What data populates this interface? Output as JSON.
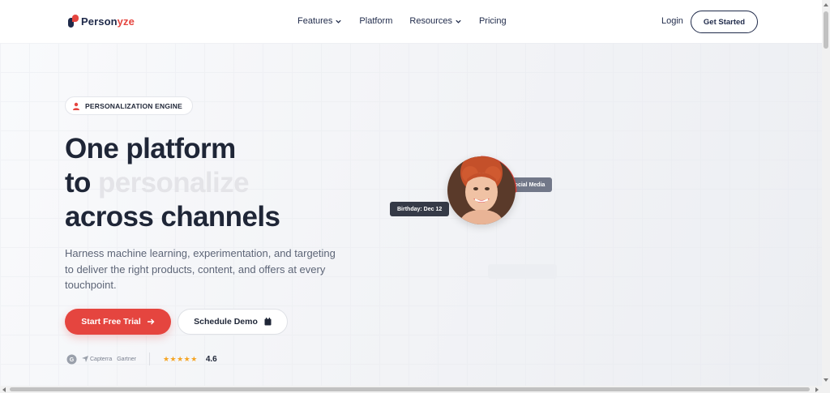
{
  "brand": {
    "name_dark": "Person",
    "name_red": "yze",
    "accent": "#e5453f",
    "dark": "#1f2a4a"
  },
  "nav": {
    "items": [
      {
        "label": "Features",
        "dropdown": true
      },
      {
        "label": "Platform",
        "dropdown": false
      },
      {
        "label": "Resources",
        "dropdown": true
      },
      {
        "label": "Pricing",
        "dropdown": false
      }
    ],
    "login": "Login",
    "cta": "Get Started"
  },
  "hero": {
    "badge": "PERSONALIZATION ENGINE",
    "title_line1": "One platform",
    "title_line2_prefix": "to ",
    "title_line2_animated": "personalize",
    "title_line3": "across channels",
    "subtitle": "Harness machine learning, experimentation, and targeting to deliver the right products, content, and offers at every touchpoint.",
    "primary_button": "Start Free Trial",
    "secondary_button": "Schedule Demo",
    "ratings": {
      "capterra": "Capterra",
      "gartner": "Gartner",
      "stars": "★★★★★",
      "score": "4.6"
    }
  },
  "visual": {
    "tag_source": "Source: Social Media",
    "tag_birthday": "Birthday: Dec 12"
  }
}
